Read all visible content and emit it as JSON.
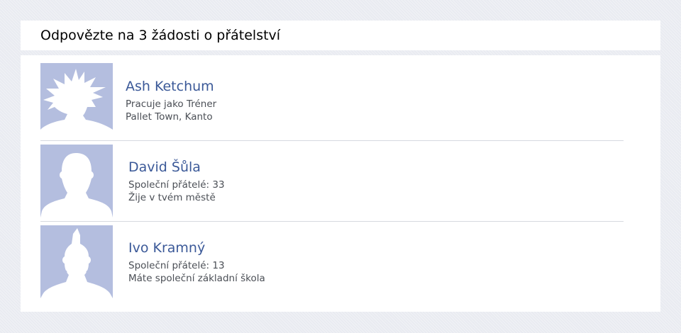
{
  "header": {
    "title": "Odpovězte na 3 žádosti o přátelství"
  },
  "requests": [
    {
      "name": "Ash Ketchum",
      "line1": "Pracuje jako Tréner",
      "line2": "Pallet Town, Kanto",
      "avatar_icon": "spiky-hair-silhouette-icon"
    },
    {
      "name": "David Šůla",
      "line1": "Společní přátelé: 33",
      "line2": "Žije v tvém městě",
      "avatar_icon": "person-silhouette-icon"
    },
    {
      "name": "Ivo Kramný",
      "line1": "Společní přátelé: 13",
      "line2": "Máte společní základní škola",
      "avatar_icon": "mohawk-silhouette-icon"
    }
  ],
  "colors": {
    "avatar_background": "#b4bedf",
    "link": "#3b5998",
    "page_background": "#e9ebf1"
  }
}
